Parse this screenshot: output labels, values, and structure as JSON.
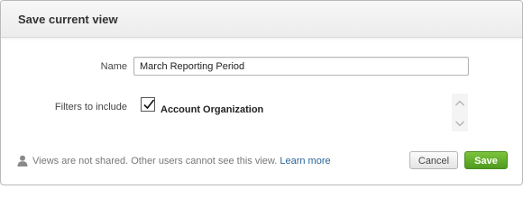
{
  "dialog": {
    "title": "Save current view"
  },
  "form": {
    "name_label": "Name",
    "name_value": "March Reporting Period",
    "filters_label": "Filters to include",
    "filters": [
      {
        "label": "Account Organization",
        "checked": true
      }
    ]
  },
  "footer": {
    "note": "Views are not shared. Other users cannot see this view.",
    "learn_more": "Learn more",
    "icon": "user-icon"
  },
  "buttons": {
    "cancel_label": "Cancel",
    "save_label": "Save"
  },
  "colors": {
    "save_button": "#5ba82a",
    "link": "#2a6496"
  }
}
